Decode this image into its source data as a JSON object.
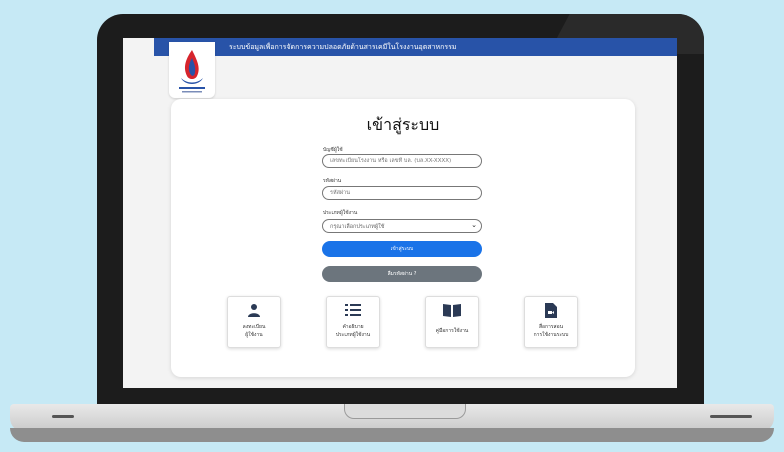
{
  "app": {
    "title": "ระบบข้อมูลเพื่อการจัดการความปลอดภัยด้านสารเคมีในโรงงานอุตสาหกรรม"
  },
  "login": {
    "heading": "เข้าสู่ระบบ",
    "account_label": "บัญชีผู้ใช้",
    "account_placeholder": "เลขทะเบียนโรงงาน หรือ เลขที่ บล. (บล.XX-XXXX)",
    "password_label": "รหัสผ่าน",
    "password_placeholder": "รหัสผ่าน",
    "usertype_label": "ประเภทผู้ใช้งาน",
    "usertype_selected": "กรุณาเลือกประเภทผู้ใช้",
    "login_button": "เข้าสู่ระบบ",
    "forgot_button": "ลืมรหัสผ่าน ?"
  },
  "tiles": [
    {
      "line1": "ลงทะเบียน",
      "line2": "ผู้ใช้งาน",
      "icon": "user-icon"
    },
    {
      "line1": "คำอธิบาย",
      "line2": "ประเภทผู้ใช้งาน",
      "icon": "list-icon"
    },
    {
      "line1": "คู่มือการใช้งาน",
      "line2": "",
      "icon": "book-icon"
    },
    {
      "line1": "สื่อการสอน",
      "line2": "การใช้งานระบบ",
      "icon": "video-file-icon"
    }
  ],
  "colors": {
    "topbar": "#2853a8",
    "login_button": "#1a73e8",
    "forgot_button": "#6c757d",
    "background": "#c6e9f5"
  }
}
